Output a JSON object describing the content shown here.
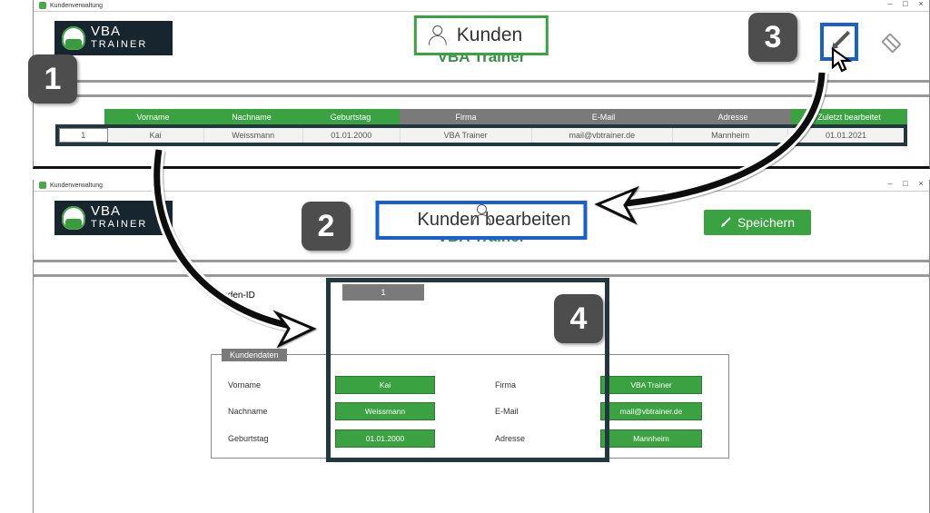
{
  "window": {
    "title": "Kundenverwaltung",
    "brand_line1": "VBA",
    "brand_line2": "TRAINER",
    "subtitle": "VBA Trainer",
    "minimize": "–",
    "maximize": "□",
    "close": "×"
  },
  "top": {
    "kunden_label": "Kunden",
    "columns": {
      "id": "",
      "vorname": "Vorname",
      "nachname": "Nachname",
      "geburtstag": "Geburtstag",
      "firma": "Firma",
      "email": "E-Mail",
      "adresse": "Adresse",
      "zuletzt": "Zuletzt bearbeitet"
    },
    "row": {
      "id": "1",
      "vorname": "Kai",
      "nachname": "Weissmann",
      "geburtstag": "01.01.2000",
      "firma": "VBA Trainer",
      "email": "mail@vbtrainer.de",
      "adresse": "Mannheim",
      "zuletzt": "01.01.2021"
    }
  },
  "bottom": {
    "title": "Kunden bearbeiten",
    "save": "Speichern",
    "kunden_id_label": "Kunden-ID",
    "kunden_id_value": "1",
    "section": "Kundendaten",
    "labels": {
      "vorname": "Vorname",
      "nachname": "Nachname",
      "geburtstag": "Geburtstag",
      "firma": "Firma",
      "email": "E-Mail",
      "adresse": "Adresse"
    },
    "values": {
      "vorname": "Kai",
      "nachname": "Weissmann",
      "geburtstag": "01.01.2000",
      "firma": "VBA Trainer",
      "email": "mail@vbtrainer.de",
      "adresse": "Mannheim"
    }
  },
  "steps": {
    "s1": "1",
    "s2": "2",
    "s3": "3",
    "s4": "4"
  }
}
